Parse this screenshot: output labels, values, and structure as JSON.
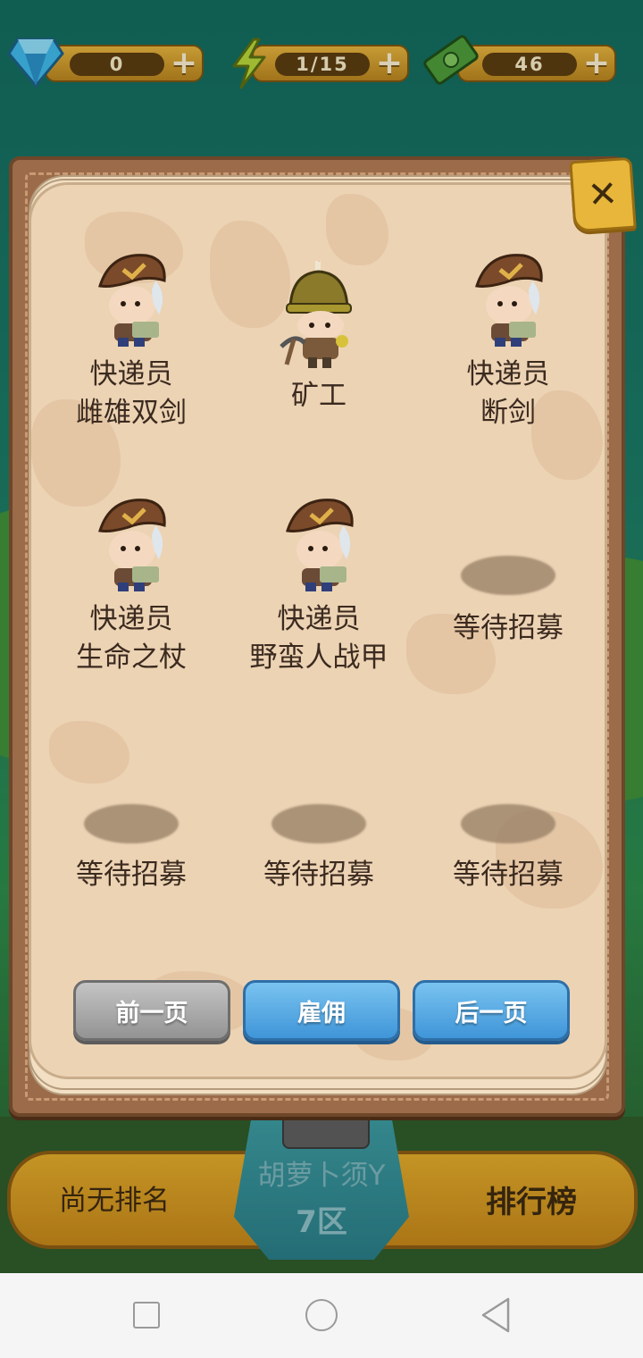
{
  "resources": [
    {
      "name": "gem",
      "icon": "diamond-icon",
      "value": "0"
    },
    {
      "name": "energy",
      "icon": "lightning-icon",
      "value": "1/15"
    },
    {
      "name": "cash",
      "icon": "cash-icon",
      "value": "46"
    }
  ],
  "panel": {
    "close_icon": "close-icon",
    "slots": [
      {
        "label": "快递员\n雌雄双剑",
        "hero": "courier"
      },
      {
        "label": "矿工",
        "hero": "miner"
      },
      {
        "label": "快递员\n断剑",
        "hero": "courier"
      },
      {
        "label": "快递员\n生命之杖",
        "hero": "courier"
      },
      {
        "label": "快递员\n野蛮人战甲",
        "hero": "courier"
      },
      {
        "label": "等待招募",
        "hero": "empty"
      },
      {
        "label": "等待招募",
        "hero": "empty"
      },
      {
        "label": "等待招募",
        "hero": "empty"
      },
      {
        "label": "等待招募",
        "hero": "empty"
      }
    ],
    "buttons": {
      "prev": "前一页",
      "hire": "雇佣",
      "next": "后一页"
    }
  },
  "bottom_bar": {
    "rank_status": "尚无排名",
    "player_name": "胡萝卜须Y",
    "player_zone": "7区",
    "leaderboard": "排行榜"
  },
  "colors": {
    "paper": "#ecd3b4",
    "frame": "#9b6b4a",
    "button_blue": "#4a9fe0",
    "button_gray": "#a8a8a8",
    "gold": "#d89f26"
  }
}
